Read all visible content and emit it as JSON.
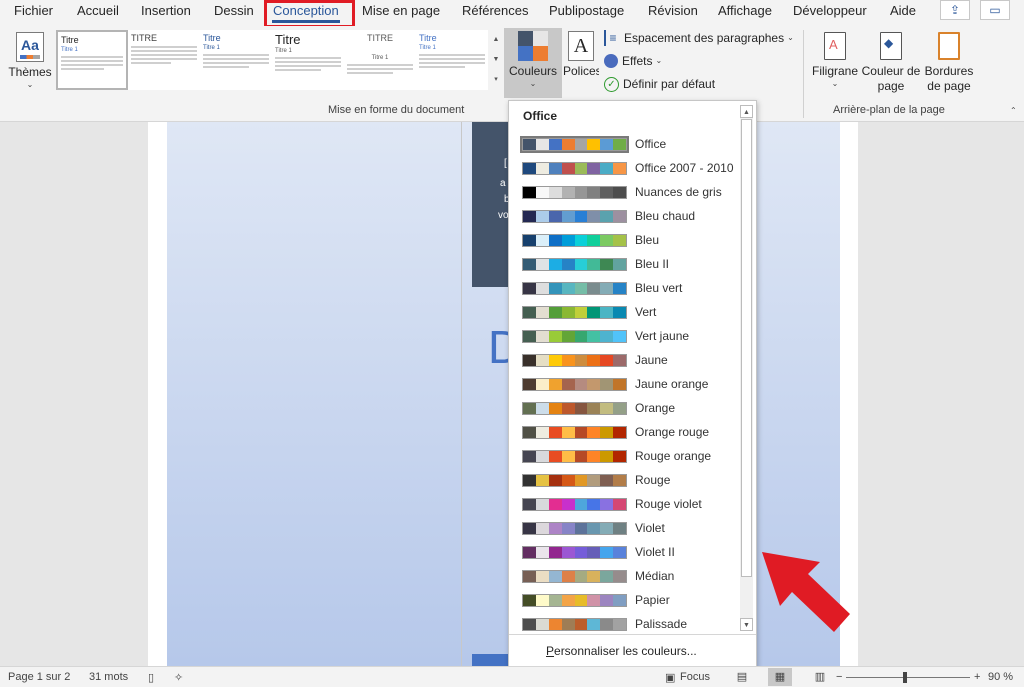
{
  "menu": {
    "tabs": [
      "Fichier",
      "Accueil",
      "Insertion",
      "Dessin",
      "Conception",
      "Mise en page",
      "Références",
      "Publipostage",
      "Révision",
      "Affichage",
      "Développeur",
      "Aide"
    ],
    "active_tab": "Conception"
  },
  "ribbon": {
    "themes_label": "Thèmes",
    "themes_icon_text": "Aa",
    "style_thumbs": [
      {
        "title": "Titre",
        "sub": "Titre 1"
      },
      {
        "title": "TITRE",
        "sub": ""
      },
      {
        "title": "Titre",
        "sub": "Titre 1"
      },
      {
        "title": "Titre",
        "sub": "Titre 1"
      },
      {
        "title": "TITRE",
        "sub": "Titre 1"
      },
      {
        "title": "Titre",
        "sub": "Titre 1"
      }
    ],
    "couleurs_label": "Couleurs",
    "polices_label": "Polices",
    "polices_icon_text": "A",
    "spacing_label": "Espacement des paragraphes",
    "effects_label": "Effets",
    "default_label": "Définir par défaut",
    "group_mise_en_forme": "Mise en forme du document",
    "filigrane_label": "Filigrane",
    "couleur_page_label_1": "Couleur de",
    "couleur_page_label_2": "page",
    "bordures_label_1": "Bordures",
    "bordures_label_2": "de page",
    "group_arriere_plan": "Arrière-plan de la page"
  },
  "document": {
    "big_letter": "D"
  },
  "dropdown": {
    "header": "Office",
    "items": [
      {
        "name": "Office",
        "colors": [
          "#44546a",
          "#e7e6e6",
          "#4472c4",
          "#ed7d31",
          "#a5a5a5",
          "#ffc000",
          "#5b9bd5",
          "#70ad47"
        ]
      },
      {
        "name": "Office 2007 - 2010",
        "colors": [
          "#1f497d",
          "#eeece1",
          "#4f81bd",
          "#c0504d",
          "#9bbb59",
          "#8064a2",
          "#4bacc6",
          "#f79646"
        ]
      },
      {
        "name": "Nuances de gris",
        "colors": [
          "#000000",
          "#f8f8f8",
          "#dddddd",
          "#b2b2b2",
          "#969696",
          "#808080",
          "#5f5f5f",
          "#4d4d4d"
        ]
      },
      {
        "name": "Bleu chaud",
        "colors": [
          "#242852",
          "#acccea",
          "#4a66ac",
          "#629dd1",
          "#297fd5",
          "#7f8fa9",
          "#5aa2ae",
          "#9d90a0"
        ]
      },
      {
        "name": "Bleu",
        "colors": [
          "#17406d",
          "#dbeff9",
          "#0f6fc6",
          "#009dd9",
          "#0bd0d9",
          "#10cf9b",
          "#7cca62",
          "#a5c249"
        ]
      },
      {
        "name": "Bleu II",
        "colors": [
          "#335b74",
          "#dfe3e5",
          "#1cade4",
          "#2683c6",
          "#27ced7",
          "#42ba97",
          "#3e8853",
          "#62a39f"
        ]
      },
      {
        "name": "Bleu vert",
        "colors": [
          "#373545",
          "#dedede",
          "#3494ba",
          "#58b6c0",
          "#75bda7",
          "#7a8c8e",
          "#84acb6",
          "#2683c6"
        ]
      },
      {
        "name": "Vert",
        "colors": [
          "#455f51",
          "#e3ded1",
          "#549e39",
          "#8ab833",
          "#c0cf3a",
          "#029676",
          "#4ab5c4",
          "#0989b1"
        ]
      },
      {
        "name": "Vert jaune",
        "colors": [
          "#455f51",
          "#e3ded1",
          "#99cb38",
          "#63a537",
          "#37a76f",
          "#44c1a3",
          "#4eb3cf",
          "#51c3f9"
        ]
      },
      {
        "name": "Jaune",
        "colors": [
          "#39302a",
          "#e5dec4",
          "#ffca08",
          "#f8931d",
          "#ce8d3e",
          "#ec7016",
          "#e64823",
          "#9c6a6a"
        ]
      },
      {
        "name": "Jaune orange",
        "colors": [
          "#4e3b30",
          "#fbeec9",
          "#f0a22e",
          "#a5644e",
          "#b58b80",
          "#c3986d",
          "#a19574",
          "#c17529"
        ]
      },
      {
        "name": "Orange",
        "colors": [
          "#637052",
          "#ccddea",
          "#e48312",
          "#bd582c",
          "#865640",
          "#9b8357",
          "#c2bc80",
          "#94a088"
        ]
      },
      {
        "name": "Orange rouge",
        "colors": [
          "#505046",
          "#eeece1",
          "#e84c22",
          "#ffbd47",
          "#b64926",
          "#ff8427",
          "#cc9900",
          "#b22600"
        ]
      },
      {
        "name": "Rouge orange",
        "colors": [
          "#454551",
          "#d8d9dc",
          "#e84c22",
          "#ffbd47",
          "#b64926",
          "#ff8427",
          "#cc9900",
          "#b22600"
        ]
      },
      {
        "name": "Rouge",
        "colors": [
          "#323232",
          "#e5c243",
          "#a5300f",
          "#d55816",
          "#e19825",
          "#b19c7d",
          "#7f5f52",
          "#b27d49"
        ]
      },
      {
        "name": "Rouge violet",
        "colors": [
          "#454551",
          "#d8d9dc",
          "#e32d91",
          "#c830cc",
          "#4ea6dc",
          "#4775e7",
          "#8971e1",
          "#d54773"
        ]
      },
      {
        "name": "Violet",
        "colors": [
          "#373545",
          "#dcd8dc",
          "#ad84c6",
          "#8784c7",
          "#5d739a",
          "#6997af",
          "#84acb6",
          "#6f8183"
        ]
      },
      {
        "name": "Violet II",
        "colors": [
          "#632e62",
          "#eae5eb",
          "#92278f",
          "#9b57d3",
          "#755dd9",
          "#665eb8",
          "#45a5ed",
          "#5982db"
        ]
      },
      {
        "name": "Médian",
        "colors": [
          "#775f55",
          "#ebddc3",
          "#94b6d2",
          "#dd8047",
          "#a5ab81",
          "#d8b25c",
          "#7ba79d",
          "#968c8c"
        ]
      },
      {
        "name": "Papier",
        "colors": [
          "#444d26",
          "#fefac9",
          "#a5b592",
          "#f3a447",
          "#e7bc29",
          "#d092a7",
          "#9c85c0",
          "#809ec2"
        ]
      },
      {
        "name": "Palissade",
        "colors": [
          "#4d4d4d",
          "#dbdbd3",
          "#ed8530",
          "#9f7d55",
          "#bc5e2b",
          "#5eb7d6",
          "#8a8a8a",
          "#a2a2a2"
        ]
      }
    ],
    "footer": "Personnaliser les couleurs..."
  },
  "status": {
    "page": "Page 1 sur 2",
    "words": "31 mots",
    "focus": "Focus",
    "zoom": "90 %"
  }
}
